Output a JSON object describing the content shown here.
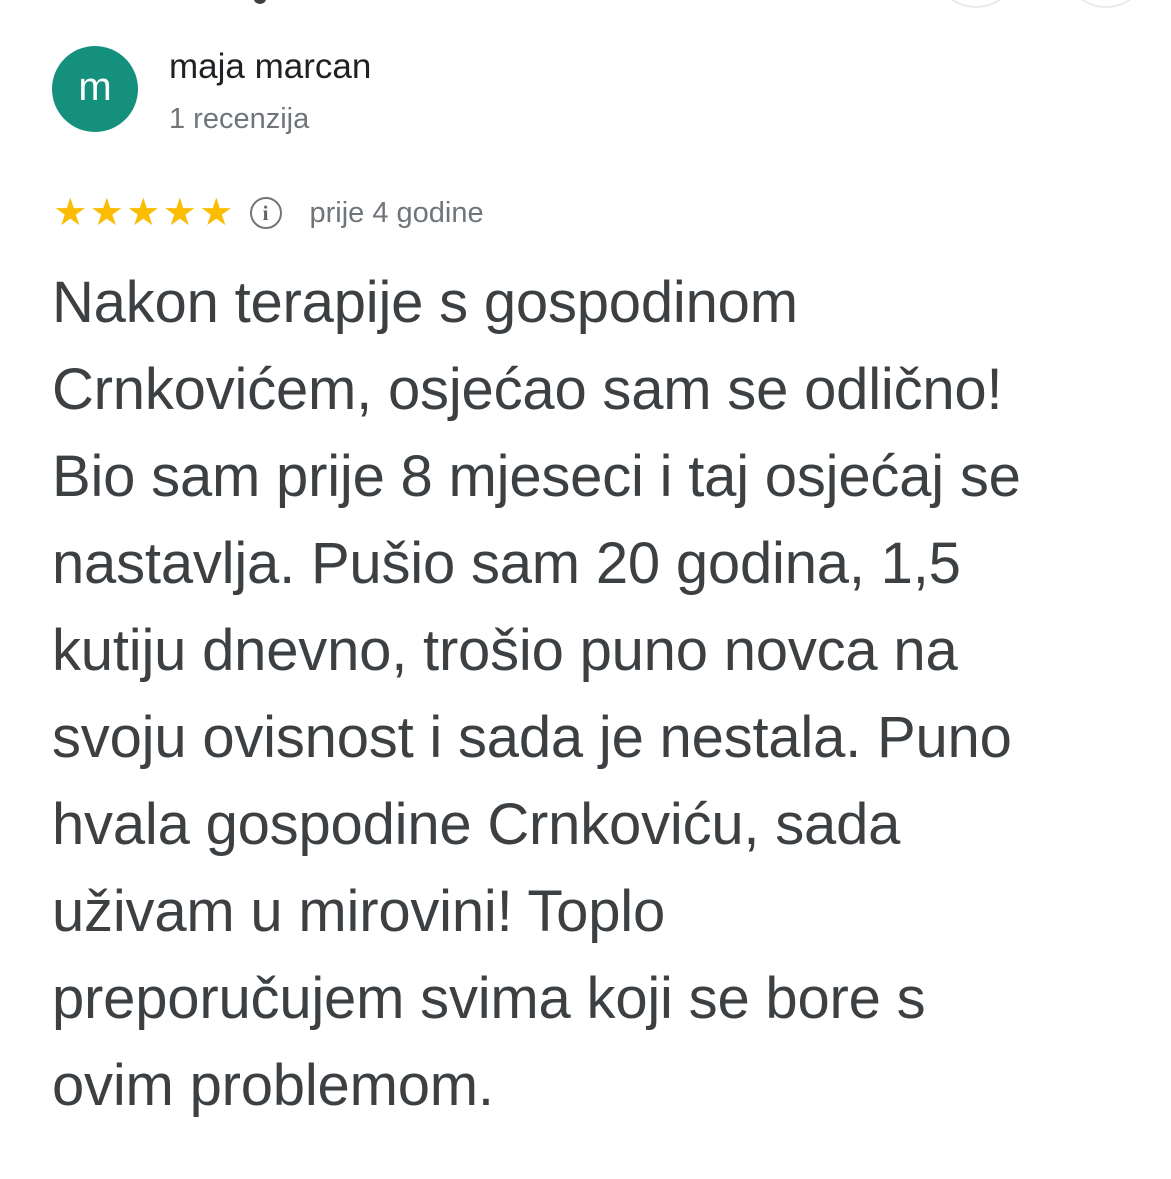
{
  "reviewer": {
    "initial": "m",
    "name": "maja marcan",
    "meta": "1 recenzija",
    "avatar_color": "#15907c"
  },
  "rating": {
    "stars": 5,
    "max": 5,
    "star_color": "#fbbc04",
    "info_glyph": "i",
    "date": "prije 4 godine"
  },
  "review": {
    "text": "Nakon terapije s gospodinom\nCrnkovićem, osjećao sam se odlično!\nBio sam prije 8 mjeseci i taj osjećaj se\nnastavlja. Pušio sam 20 godina, 1,5\nkutiju dnevno, trošio puno novca na\nsvoju ovisnost i sada je nestala. Puno\nhvala gospodine Crnkoviću, sada\nuživam u mirovini! Toplo\npreporučujem svima koji se bore s\novim problemom."
  }
}
